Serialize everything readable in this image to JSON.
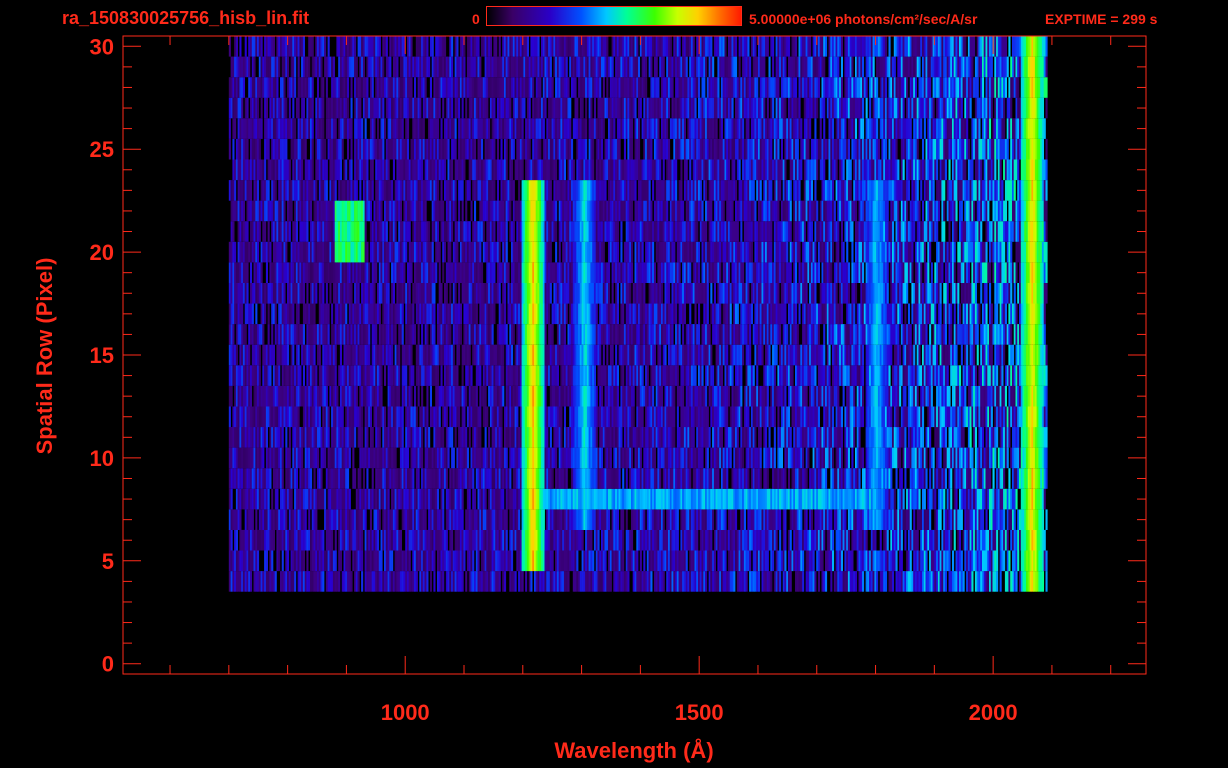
{
  "header": {
    "file_name": "ra_150830025756_hisb_lin.fit",
    "colorbar_min": "0",
    "colorbar_max_label": "5.00000e+06 photons/cm²/sec/A/sr",
    "exptime": "EXPTIME = 299 s"
  },
  "colors": {
    "axis": "#ff2a1a",
    "background": "#000000"
  },
  "chart_data": {
    "type": "heatmap",
    "title": "ra_150830025756_hisb_lin.fit",
    "xlabel": "Wavelength (Å)",
    "ylabel": "Spatial Row (Pixel)",
    "xlim": [
      520,
      2260
    ],
    "ylim": [
      -0.5,
      30.5
    ],
    "x_ticks": [
      1000,
      1500,
      2000
    ],
    "x_tick_labels": [
      "1000",
      "1500",
      "2000"
    ],
    "y_ticks": [
      0,
      5,
      10,
      15,
      20,
      25,
      30
    ],
    "y_tick_labels": [
      "0",
      "5",
      "10",
      "15",
      "20",
      "25",
      "30"
    ],
    "x_minor_step": 100,
    "y_minor_step": 1,
    "color_range": [
      0,
      5000000
    ],
    "color_units": "photons/cm²/sec/A/sr",
    "data_x_range": [
      700,
      2090
    ],
    "data_rows": [
      4,
      30
    ],
    "bright_features": [
      {
        "wavelength": 1216,
        "rows": [
          5,
          23
        ],
        "level": 0.8
      },
      {
        "wavelength": 1304,
        "rows": [
          7,
          23
        ],
        "level": 0.45
      },
      {
        "wavelength": 1800,
        "rows": [
          7,
          23
        ],
        "level": 0.42
      },
      {
        "wavelength": 2065,
        "rows": [
          2,
          30
        ],
        "level": 0.78
      }
    ],
    "structures": [
      {
        "name": "upper-arc",
        "wavelength_range": [
          880,
          930
        ],
        "rows": [
          20,
          22
        ],
        "level": 0.62
      },
      {
        "name": "lower-band",
        "wavelength_range": [
          1216,
          1800
        ],
        "rows": [
          8,
          8
        ],
        "level": 0.48
      }
    ]
  }
}
